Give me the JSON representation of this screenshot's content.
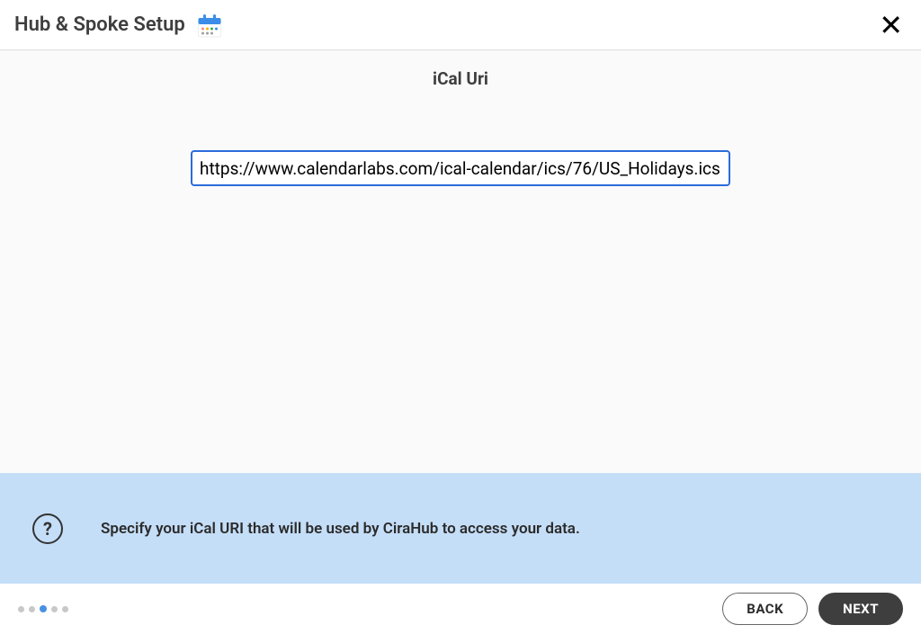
{
  "header": {
    "title": "Hub & Spoke Setup"
  },
  "main": {
    "section_title": "iCal Uri",
    "ical_uri_value": "https://www.calendarlabs.com/ical-calendar/ics/76/US_Holidays.ics"
  },
  "help": {
    "text": "Specify your iCal URI that will be used by CiraHub to access your data."
  },
  "footer": {
    "back_label": "BACK",
    "next_label": "NEXT",
    "progress_total": 5,
    "progress_current_index": 2
  }
}
